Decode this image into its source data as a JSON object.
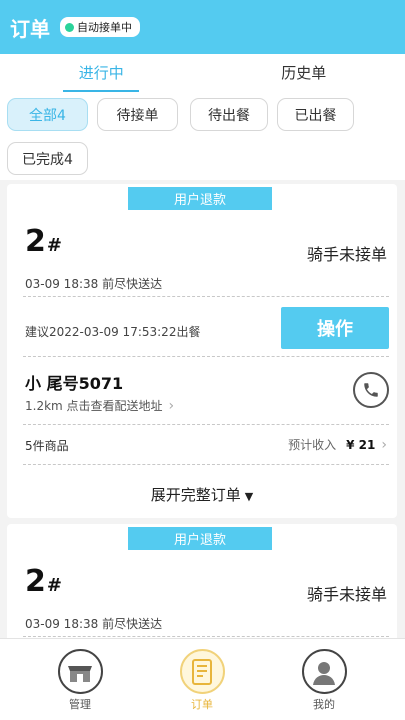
{
  "header": {
    "title": "订单",
    "auto_accept": "自动接单中"
  },
  "tabs": [
    {
      "label": "进行中"
    },
    {
      "label": "历史单"
    }
  ],
  "filters": [
    {
      "label": "全部4"
    },
    {
      "label": "待接单"
    },
    {
      "label": "待出餐"
    },
    {
      "label": "已出餐"
    },
    {
      "label": "已完成4"
    }
  ],
  "orders": [
    {
      "tag": "用户退款",
      "number": "2",
      "hash": "#",
      "rider_status": "骑手未接单",
      "deliver_time": "03-09 18:38 前尽快送达",
      "suggest": "建议2022-03-09 17:53:22出餐",
      "action": "操作",
      "customer": "小  尾号5071",
      "distance": "1.2km  点击查看配送地址",
      "goods": "5件商品",
      "income_label": "预计收入",
      "income": "¥ 21",
      "expand": "展开完整订单"
    },
    {
      "tag": "用户退款",
      "number": "2",
      "hash": "#",
      "rider_status": "骑手未接单",
      "deliver_time": "03-09 18:38 前尽快送达"
    }
  ],
  "bottom_nav": [
    {
      "label": "管理",
      "icon": "store-icon"
    },
    {
      "label": "订单",
      "icon": "order-list-icon"
    },
    {
      "label": "我的",
      "icon": "user-icon"
    }
  ],
  "colors": {
    "accent": "#54cbf0",
    "tab_active": "#39b5e6",
    "badge_dot": "#2bd39a",
    "nav_active": "#e8b53b"
  }
}
